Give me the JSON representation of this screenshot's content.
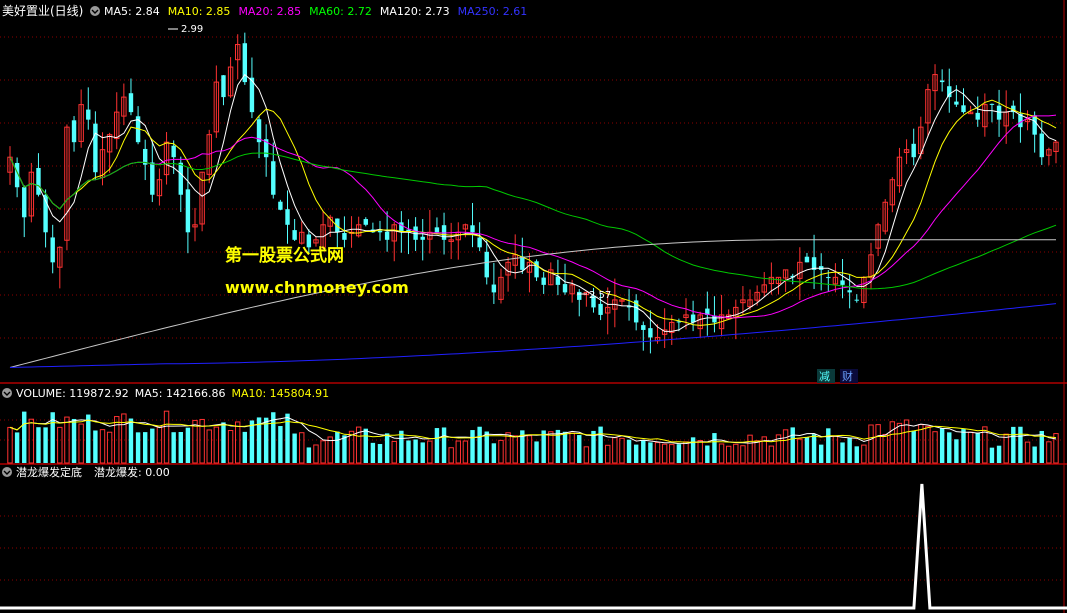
{
  "main_panel": {
    "title": "美好置业(日线)",
    "indicators": [
      {
        "label": "MA5: 2.84",
        "color": "#ffffff"
      },
      {
        "label": "MA10: 2.85",
        "color": "#ffff00"
      },
      {
        "label": "MA20: 2.85",
        "color": "#ff00ff"
      },
      {
        "label": "MA60: 2.72",
        "color": "#00ff00"
      },
      {
        "label": "MA120: 2.73",
        "color": "#ffffff"
      },
      {
        "label": "MA250: 2.61",
        "color": "#3333ff"
      }
    ],
    "high_marker": "2.99",
    "low_marker": "2.57",
    "watermark_line1": "第一股票公式网",
    "watermark_line2": "www.chnmoney.com",
    "badge_left": "减",
    "badge_right": "财"
  },
  "volume_panel": {
    "label": "VOLUME: 119872.92",
    "ma5": "MA5: 142166.86",
    "ma10": "MA10: 145804.91"
  },
  "indicator_panel": {
    "name": "潜龙爆发定底",
    "value_label": "潜龙爆发: 0.00"
  },
  "colors": {
    "up": "#ff3232",
    "down": "#54ffff",
    "grid": "#8b0000",
    "ma5": "#ffffff",
    "ma10": "#ffff00",
    "ma20": "#ff00ff",
    "ma60": "#00c800",
    "ma120": "#c8c8c8",
    "ma250": "#2020ff",
    "watermark": "#ffff00"
  },
  "chart_data": [
    {
      "type": "candlestick",
      "ylim": [
        2.55,
        3.02
      ],
      "closes": [
        2.84,
        2.8,
        2.76,
        2.82,
        2.79,
        2.74,
        2.7,
        2.72,
        2.88,
        2.86,
        2.91,
        2.89,
        2.82,
        2.85,
        2.87,
        2.9,
        2.92,
        2.9,
        2.86,
        2.83,
        2.79,
        2.81,
        2.86,
        2.84,
        2.79,
        2.74,
        2.75,
        2.82,
        2.87,
        2.94,
        2.92,
        2.96,
        2.99,
        2.94,
        2.9,
        2.86,
        2.84,
        2.79,
        2.77,
        2.75,
        2.73,
        2.74,
        2.72,
        2.73,
        2.75,
        2.76,
        2.74,
        2.73,
        2.74,
        2.75,
        2.75,
        2.74,
        2.74,
        2.73,
        2.75,
        2.74,
        2.74,
        2.73,
        2.73,
        2.74,
        2.74,
        2.73,
        2.73,
        2.74,
        2.75,
        2.74,
        2.72,
        2.68,
        2.66,
        2.68,
        2.7,
        2.71,
        2.69,
        2.7,
        2.68,
        2.67,
        2.69,
        2.67,
        2.66,
        2.67,
        2.65,
        2.66,
        2.64,
        2.63,
        2.64,
        2.65,
        2.65,
        2.64,
        2.62,
        2.61,
        2.6,
        2.6,
        2.61,
        2.62,
        2.62,
        2.63,
        2.62,
        2.63,
        2.63,
        2.62,
        2.63,
        2.63,
        2.64,
        2.65,
        2.65,
        2.66,
        2.67,
        2.68,
        2.68,
        2.69,
        2.68,
        2.7,
        2.7,
        2.69,
        2.69,
        2.68,
        2.68,
        2.67,
        2.66,
        2.65,
        2.68,
        2.71,
        2.75,
        2.78,
        2.81,
        2.84,
        2.85,
        2.84,
        2.88,
        2.93,
        2.95,
        2.94,
        2.92,
        2.91,
        2.9,
        2.9,
        2.89,
        2.91,
        2.91,
        2.89,
        2.9,
        2.9,
        2.88,
        2.89,
        2.87,
        2.84,
        2.85,
        2.86
      ],
      "high_label": 2.99,
      "low_label": 2.57,
      "series": [
        {
          "name": "MA5",
          "value": 2.84
        },
        {
          "name": "MA10",
          "value": 2.85
        },
        {
          "name": "MA20",
          "value": 2.85
        },
        {
          "name": "MA60",
          "value": 2.72
        },
        {
          "name": "MA120",
          "value": 2.73
        },
        {
          "name": "MA250",
          "value": 2.61
        }
      ]
    },
    {
      "type": "bar",
      "series": [
        {
          "name": "VOLUME",
          "value": 119872.92
        },
        {
          "name": "MA5",
          "value": 142166.86
        },
        {
          "name": "MA10",
          "value": 145804.91
        }
      ]
    },
    {
      "type": "line",
      "series": [
        {
          "name": "潜龙爆发",
          "value": 0.0,
          "spike_index_fraction": 0.864,
          "spike_height": 1.0
        }
      ]
    }
  ]
}
